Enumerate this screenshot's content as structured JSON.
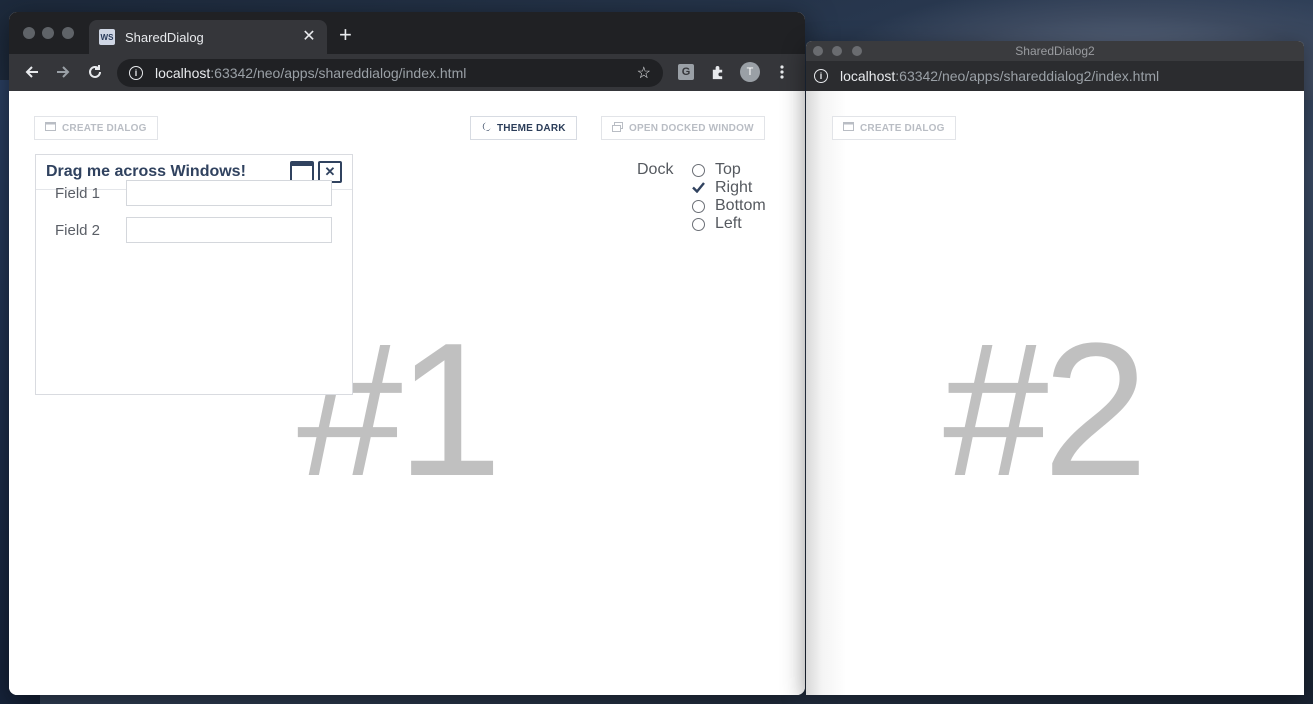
{
  "window1": {
    "tab_title": "SharedDialog",
    "tab_favicon": "WS",
    "tab_close": "✕",
    "new_tab": "+",
    "url_host": "localhost",
    "url_path": ":63342/neo/apps/shareddialog/index.html",
    "ext_g": "G",
    "avatar_letter": "T",
    "buttons": {
      "create_dialog": "CREATE DIALOG",
      "theme_dark": "THEME DARK",
      "open_docked_window": "OPEN DOCKED WINDOW"
    },
    "dialog": {
      "title": "Drag me across Windows!",
      "fields": [
        {
          "label": "Field 1",
          "value": ""
        },
        {
          "label": "Field 2",
          "value": ""
        }
      ]
    },
    "dock": {
      "label": "Dock",
      "options": [
        "Top",
        "Right",
        "Bottom",
        "Left"
      ],
      "selected": "Right"
    },
    "watermark": "#1"
  },
  "window2": {
    "title": "SharedDialog2",
    "url_host": "localhost",
    "url_path": ":63342/neo/apps/shareddialog2/index.html",
    "buttons": {
      "create_dialog": "CREATE DIALOG"
    },
    "watermark": "#2"
  },
  "icons": {
    "back": "back-arrow-icon",
    "forward": "forward-arrow-icon",
    "reload": "reload-icon",
    "info": "info-icon",
    "star": "bookmark-star-icon",
    "extensions": "puzzle-icon",
    "menu": "kebab-menu-icon",
    "moon": "moon-icon",
    "window": "window-icon",
    "maximize": "maximize-icon",
    "close": "close-icon",
    "check": "check-icon"
  },
  "colors": {
    "accent": "#30425f",
    "watermark": "#c0c0c0",
    "chrome_dark": "#202124",
    "chrome_toolbar": "#35363a"
  }
}
